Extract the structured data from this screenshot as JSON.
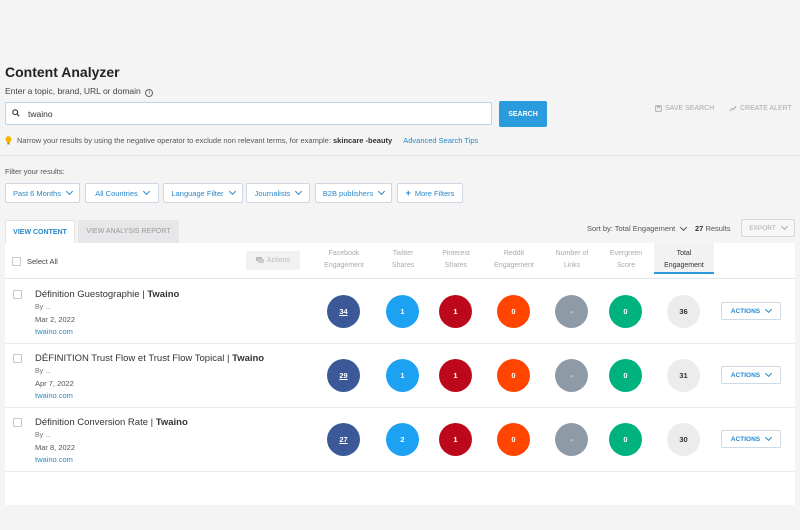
{
  "page": {
    "title": "Content Analyzer",
    "subtitle": "Enter a topic, brand, URL or domain"
  },
  "search": {
    "value": "twaino",
    "button_label": "SEARCH",
    "save_label": "SAVE SEARCH",
    "alert_label": "CREATE ALERT"
  },
  "tip": {
    "text": "Narrow your results by using the negative operator to exclude non relevant terms, for example:",
    "example": "skincare -beauty",
    "link": "Advanced Search Tips"
  },
  "filters": {
    "label": "Filter your results:",
    "items": [
      "Past 6 Months",
      "All Countries",
      "Language Filter",
      "Journalists",
      "B2B publishers"
    ],
    "more_label": "More Filters"
  },
  "tabs": {
    "view_content": "VIEW CONTENT",
    "view_analysis": "VIEW ANALYSIS REPORT"
  },
  "sort": {
    "label": "Sort by: Total Engagement",
    "count": "27",
    "count_suffix": "Results",
    "export_label": "EXPORT"
  },
  "table": {
    "select_all": "Select All",
    "actions_label": "Actions",
    "columns": [
      {
        "line1": "Facebook",
        "line2": "Engagement"
      },
      {
        "line1": "Twitter",
        "line2": "Shares"
      },
      {
        "line1": "Pinterest",
        "line2": "Shares"
      },
      {
        "line1": "Reddit",
        "line2": "Engagement"
      },
      {
        "line1": "Number of",
        "line2": "Links"
      },
      {
        "line1": "Evergreen",
        "line2": "Score"
      },
      {
        "line1": "Total",
        "line2": "Engagement"
      }
    ],
    "row_actions_label": "ACTIONS",
    "rows": [
      {
        "title_main": "Définition Guestographie | ",
        "title_brand": "Twaino",
        "by": "By ...",
        "date": "Mar 2, 2022",
        "domain": "twaino.com",
        "facebook": "34",
        "twitter": "1",
        "pinterest": "1",
        "reddit": "0",
        "links": "-",
        "evergreen": "0",
        "total": "36"
      },
      {
        "title_main": "DÉFINITION Trust Flow et Trust Flow Topical | ",
        "title_brand": "Twaino",
        "by": "By ...",
        "date": "Apr 7, 2022",
        "domain": "twaino.com",
        "facebook": "29",
        "twitter": "1",
        "pinterest": "1",
        "reddit": "0",
        "links": "-",
        "evergreen": "0",
        "total": "31"
      },
      {
        "title_main": "Définition Conversion Rate | ",
        "title_brand": "Twaino",
        "by": "By ...",
        "date": "Mar 8, 2022",
        "domain": "twaino.com",
        "facebook": "27",
        "twitter": "2",
        "pinterest": "1",
        "reddit": "0",
        "links": "-",
        "evergreen": "0",
        "total": "30"
      }
    ]
  },
  "colors": {
    "accent": "#2a9bdc",
    "facebook": "#3b5998",
    "twitter": "#1da1f2",
    "pinterest": "#bd081c",
    "reddit": "#ff4500",
    "links": "#8e9ba7",
    "evergreen": "#00b37e"
  }
}
